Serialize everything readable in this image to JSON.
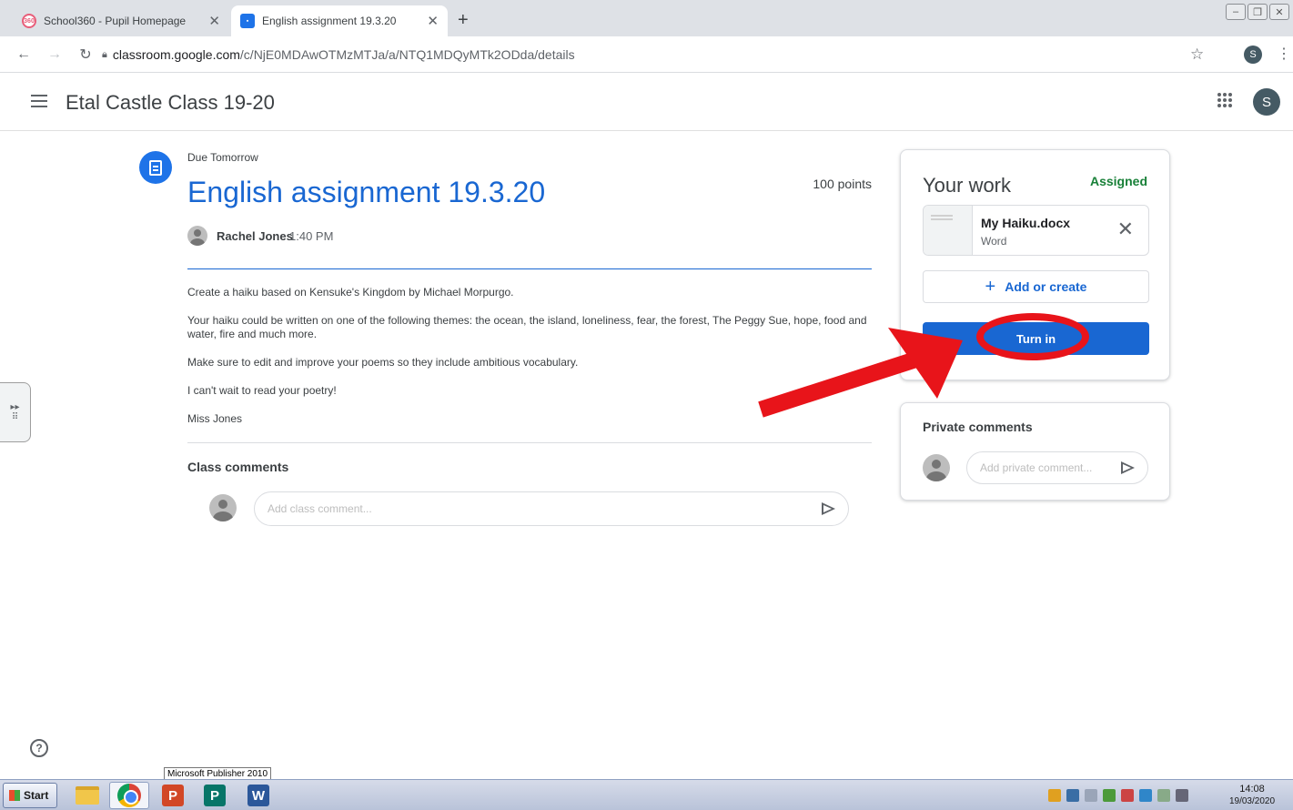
{
  "browser": {
    "tabs": [
      {
        "title": "School360 - Pupil Homepage",
        "favicon_text": "360",
        "active": false
      },
      {
        "title": "English assignment 19.3.20",
        "active": true
      }
    ],
    "url_host": "classroom.google.com",
    "url_path": "/c/NjE0MDAwOTMzMTJa/a/NTQ1MDQyMTk2ODda/details",
    "profile_initial": "S"
  },
  "header": {
    "class_name": "Etal Castle Class 19-20",
    "profile_initial": "S"
  },
  "assignment": {
    "due": "Due Tomorrow",
    "title": "English assignment 19.3.20",
    "points": "100 points",
    "author": "Rachel Jones",
    "time": "1:40 PM",
    "instructions": [
      "Create a haiku based on Kensuke's Kingdom by Michael Morpurgo.",
      "Your haiku could be written on one of the following themes: the ocean, the island, loneliness, fear, the forest, The Peggy Sue, hope, food and water, fire and much more.",
      "Make sure to edit and improve your poems so they include ambitious vocabulary.",
      "I can't wait to read your poetry!",
      "Miss Jones"
    ],
    "class_comments_heading": "Class comments",
    "class_comment_placeholder": "Add class comment..."
  },
  "your_work": {
    "title": "Your work",
    "status": "Assigned",
    "attachment_name": "My Haiku.docx",
    "attachment_type": "Word",
    "add_or_create": "Add or create",
    "turn_in": "Turn in"
  },
  "private_comments": {
    "title": "Private comments",
    "placeholder": "Add private comment..."
  },
  "taskbar": {
    "start_label": "Start",
    "tooltip": "Microsoft Publisher 2010",
    "time": "14:08",
    "date": "19/03/2020"
  },
  "colors": {
    "accent_blue": "#1967d2",
    "status_green": "#188038",
    "annotation_red": "#e8141a"
  }
}
